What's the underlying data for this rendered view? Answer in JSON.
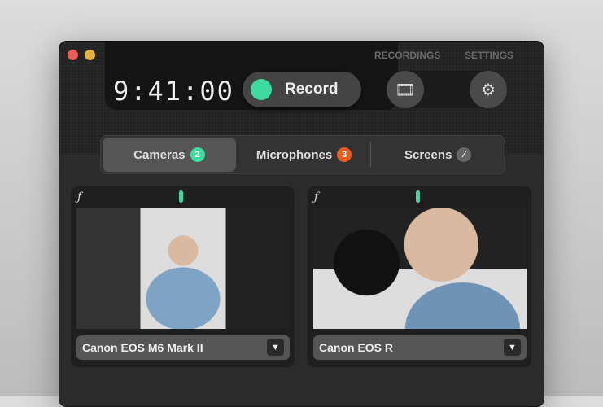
{
  "header": {
    "time": "9:41:00",
    "record_label": "Record",
    "recordings_label": "RECORDINGS",
    "settings_label": "SETTINGS"
  },
  "tabs": [
    {
      "label": "Cameras",
      "badge": "2"
    },
    {
      "label": "Microphones",
      "badge": "3"
    },
    {
      "label": "Screens"
    }
  ],
  "colors": {
    "accent": "#3ddba0",
    "orange": "#f05a1a"
  },
  "cameras": [
    {
      "name": "Canon EOS M6 Mark II",
      "icon": "ƒ"
    },
    {
      "name": "Canon EOS R",
      "icon": "ƒ"
    }
  ]
}
